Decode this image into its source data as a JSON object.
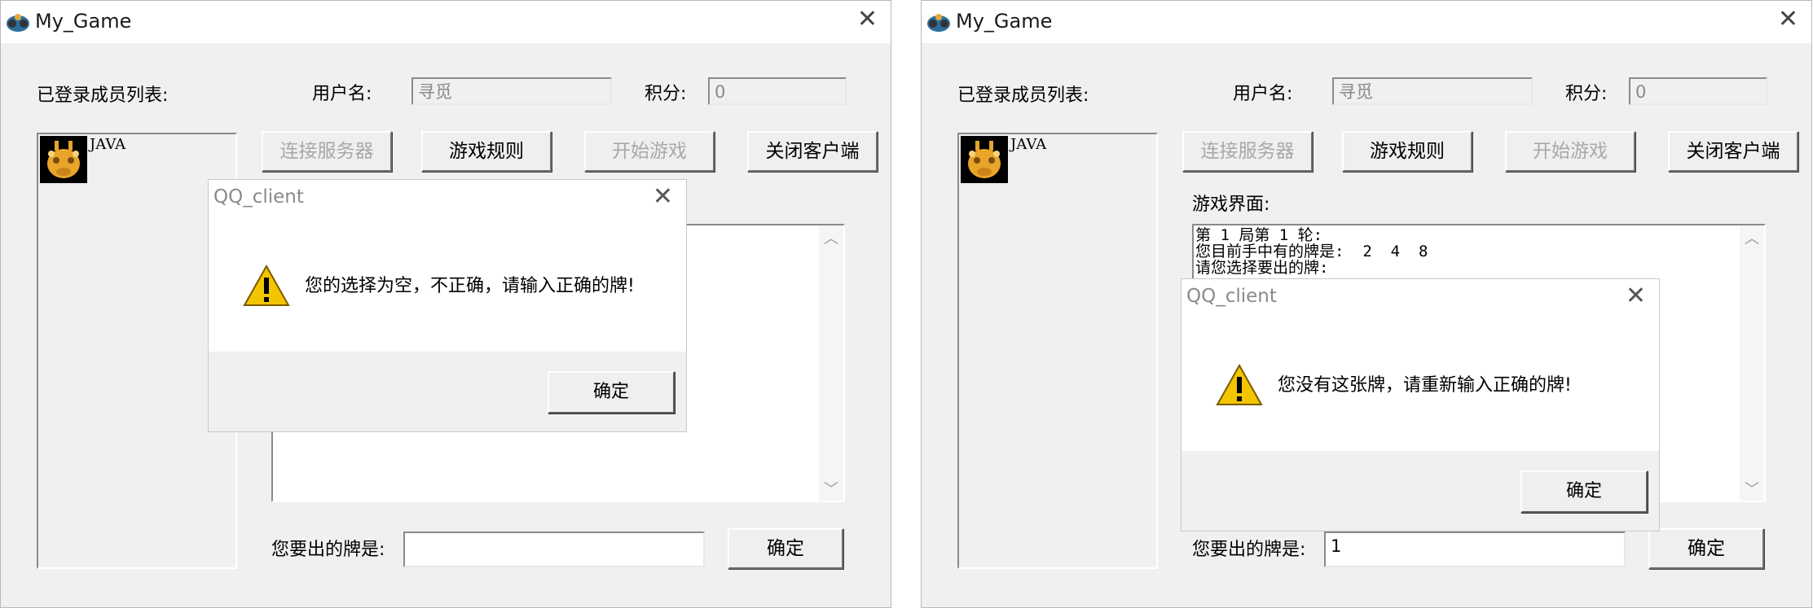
{
  "windows": [
    {
      "title": "My_Game",
      "members_label": "已登录成员列表:",
      "username_label": "用户名:",
      "username_value": "寻觅",
      "score_label": "积分:",
      "score_value": "0",
      "members": [
        {
          "name": "JAVA"
        }
      ],
      "buttons": {
        "connect": "连接服务器",
        "rules": "游戏规则",
        "start": "开始游戏",
        "close_client": "关闭客户端",
        "confirm": "确定"
      },
      "game_area_label": "",
      "game_text": [],
      "card_prompt_label": "您要出的牌是:",
      "card_input_value": "",
      "dialog": {
        "title": "QQ_client",
        "message": "您的选择为空，不正确，请输入正确的牌!",
        "ok": "确定"
      }
    },
    {
      "title": "My_Game",
      "members_label": "已登录成员列表:",
      "username_label": "用户名:",
      "username_value": "寻觅",
      "score_label": "积分:",
      "score_value": "0",
      "members": [
        {
          "name": "JAVA"
        }
      ],
      "buttons": {
        "connect": "连接服务器",
        "rules": "游戏规则",
        "start": "开始游戏",
        "close_client": "关闭客户端",
        "confirm": "确定"
      },
      "game_area_label": "游戏界面:",
      "game_text": [
        "第 1 局第 1 轮:",
        "您目前手中有的牌是:  2  4  8",
        "请您选择要出的牌:"
      ],
      "card_prompt_label": "您要出的牌是:",
      "card_input_value": "1",
      "dialog": {
        "title": "QQ_client",
        "message": "您没有这张牌，请重新输入正确的牌!",
        "ok": "确定"
      }
    }
  ],
  "colors": {
    "window_bg": "#f0f0f0",
    "disabled_text": "#a8a8a8",
    "warning_yellow": "#f2c500"
  },
  "icons": {
    "app": "gamepad-icon",
    "member_avatar": "giraffe-avatar",
    "dialog": "warning-icon"
  }
}
